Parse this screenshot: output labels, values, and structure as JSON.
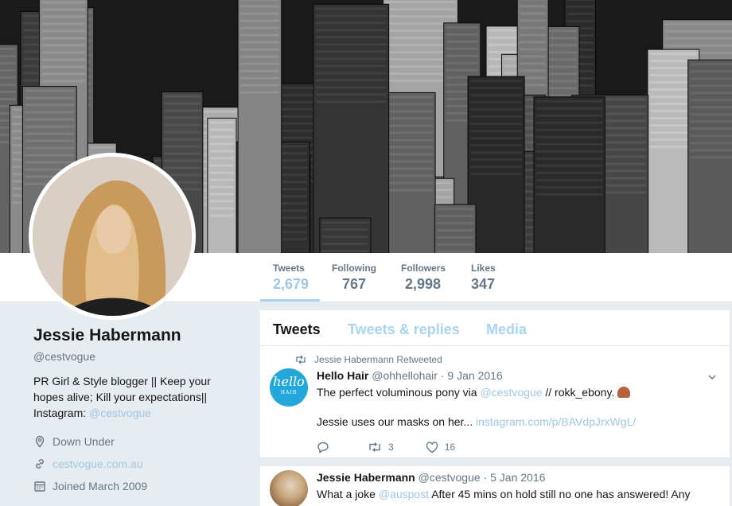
{
  "profile": {
    "name": "Jessie Habermann",
    "handle": "@cestvogue",
    "bio_text": "PR Girl & Style blogger || Keep your hopes alive; Kill your expectations|| Instagram: ",
    "bio_link": "@cestvogue",
    "location": "Down Under",
    "website": "cestvogue.com.au",
    "joined": "Joined March 2009"
  },
  "stats": [
    {
      "label": "Tweets",
      "value": "2,679"
    },
    {
      "label": "Following",
      "value": "767"
    },
    {
      "label": "Followers",
      "value": "2,998"
    },
    {
      "label": "Likes",
      "value": "347"
    }
  ],
  "tabs": [
    "Tweets",
    "Tweets & replies",
    "Media"
  ],
  "tweets": [
    {
      "retweet_label": "Jessie Habermann Retweeted",
      "author": "Hello Hair",
      "handle": "@ohhellohair",
      "date": "· 9 Jan 2016",
      "avatar_text": "hello",
      "avatar_subtext": "HAIR",
      "line1_pre": "The perfect voluminous pony via ",
      "line1_link": "@cestvogue",
      "line1_post": " // rokk_ebony.",
      "line2_pre": "Jessie uses our masks on her... ",
      "line2_link": "instagram.com/p/BAVdpJrxWgL/",
      "retweets": "3",
      "likes": "16"
    },
    {
      "author": "Jessie Habermann",
      "handle": "@cestvogue",
      "date": "· 5 Jan 2016",
      "line1_pre": "What a joke ",
      "line1_link": "@auspost",
      "line1_post": " After 45 mins on hold still no one has answered! Any"
    }
  ],
  "colors": {
    "accent_link": "#9fc7e3",
    "text": "#14171a",
    "muted": "#657786",
    "background": "#e6ecf0"
  },
  "icons": [
    "retweet-icon",
    "reply-icon",
    "heart-icon",
    "location-pin-icon",
    "link-icon",
    "calendar-icon",
    "chevron-down-icon"
  ]
}
